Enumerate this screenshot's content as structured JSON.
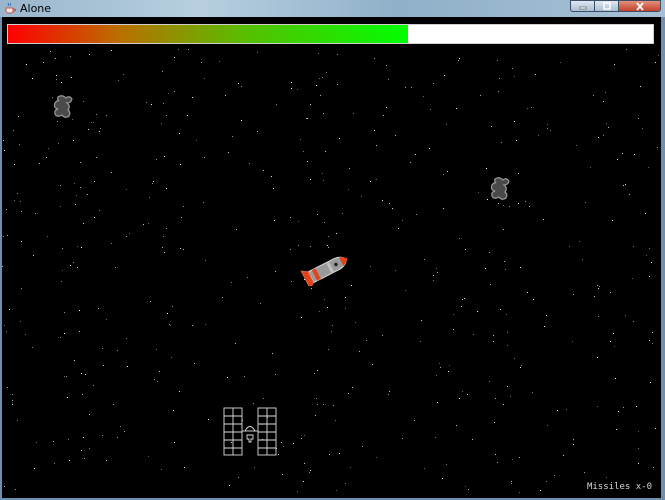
{
  "window": {
    "title": "Alone",
    "icon": "java-cup-icon"
  },
  "window_controls": [
    "minimize-icon",
    "maximize-icon",
    "close-icon"
  ],
  "colors": {
    "background": "#000000",
    "health_start": "#ff0000",
    "health_end": "#00ff00",
    "health_empty": "#ffffff",
    "star": "#ffffff",
    "rocket_accent": "#e0441c"
  },
  "game": {
    "health": {
      "fraction": 0.62
    },
    "player": {
      "sprite": "rocket-ship-icon",
      "heading": "up-right"
    },
    "enemies": [
      {
        "sprite": "alien-creature-icon"
      },
      {
        "sprite": "alien-creature-icon"
      }
    ],
    "station": {
      "sprite": "space-station-icon"
    },
    "hud": {
      "missiles_text": "Missiles x-0"
    }
  }
}
